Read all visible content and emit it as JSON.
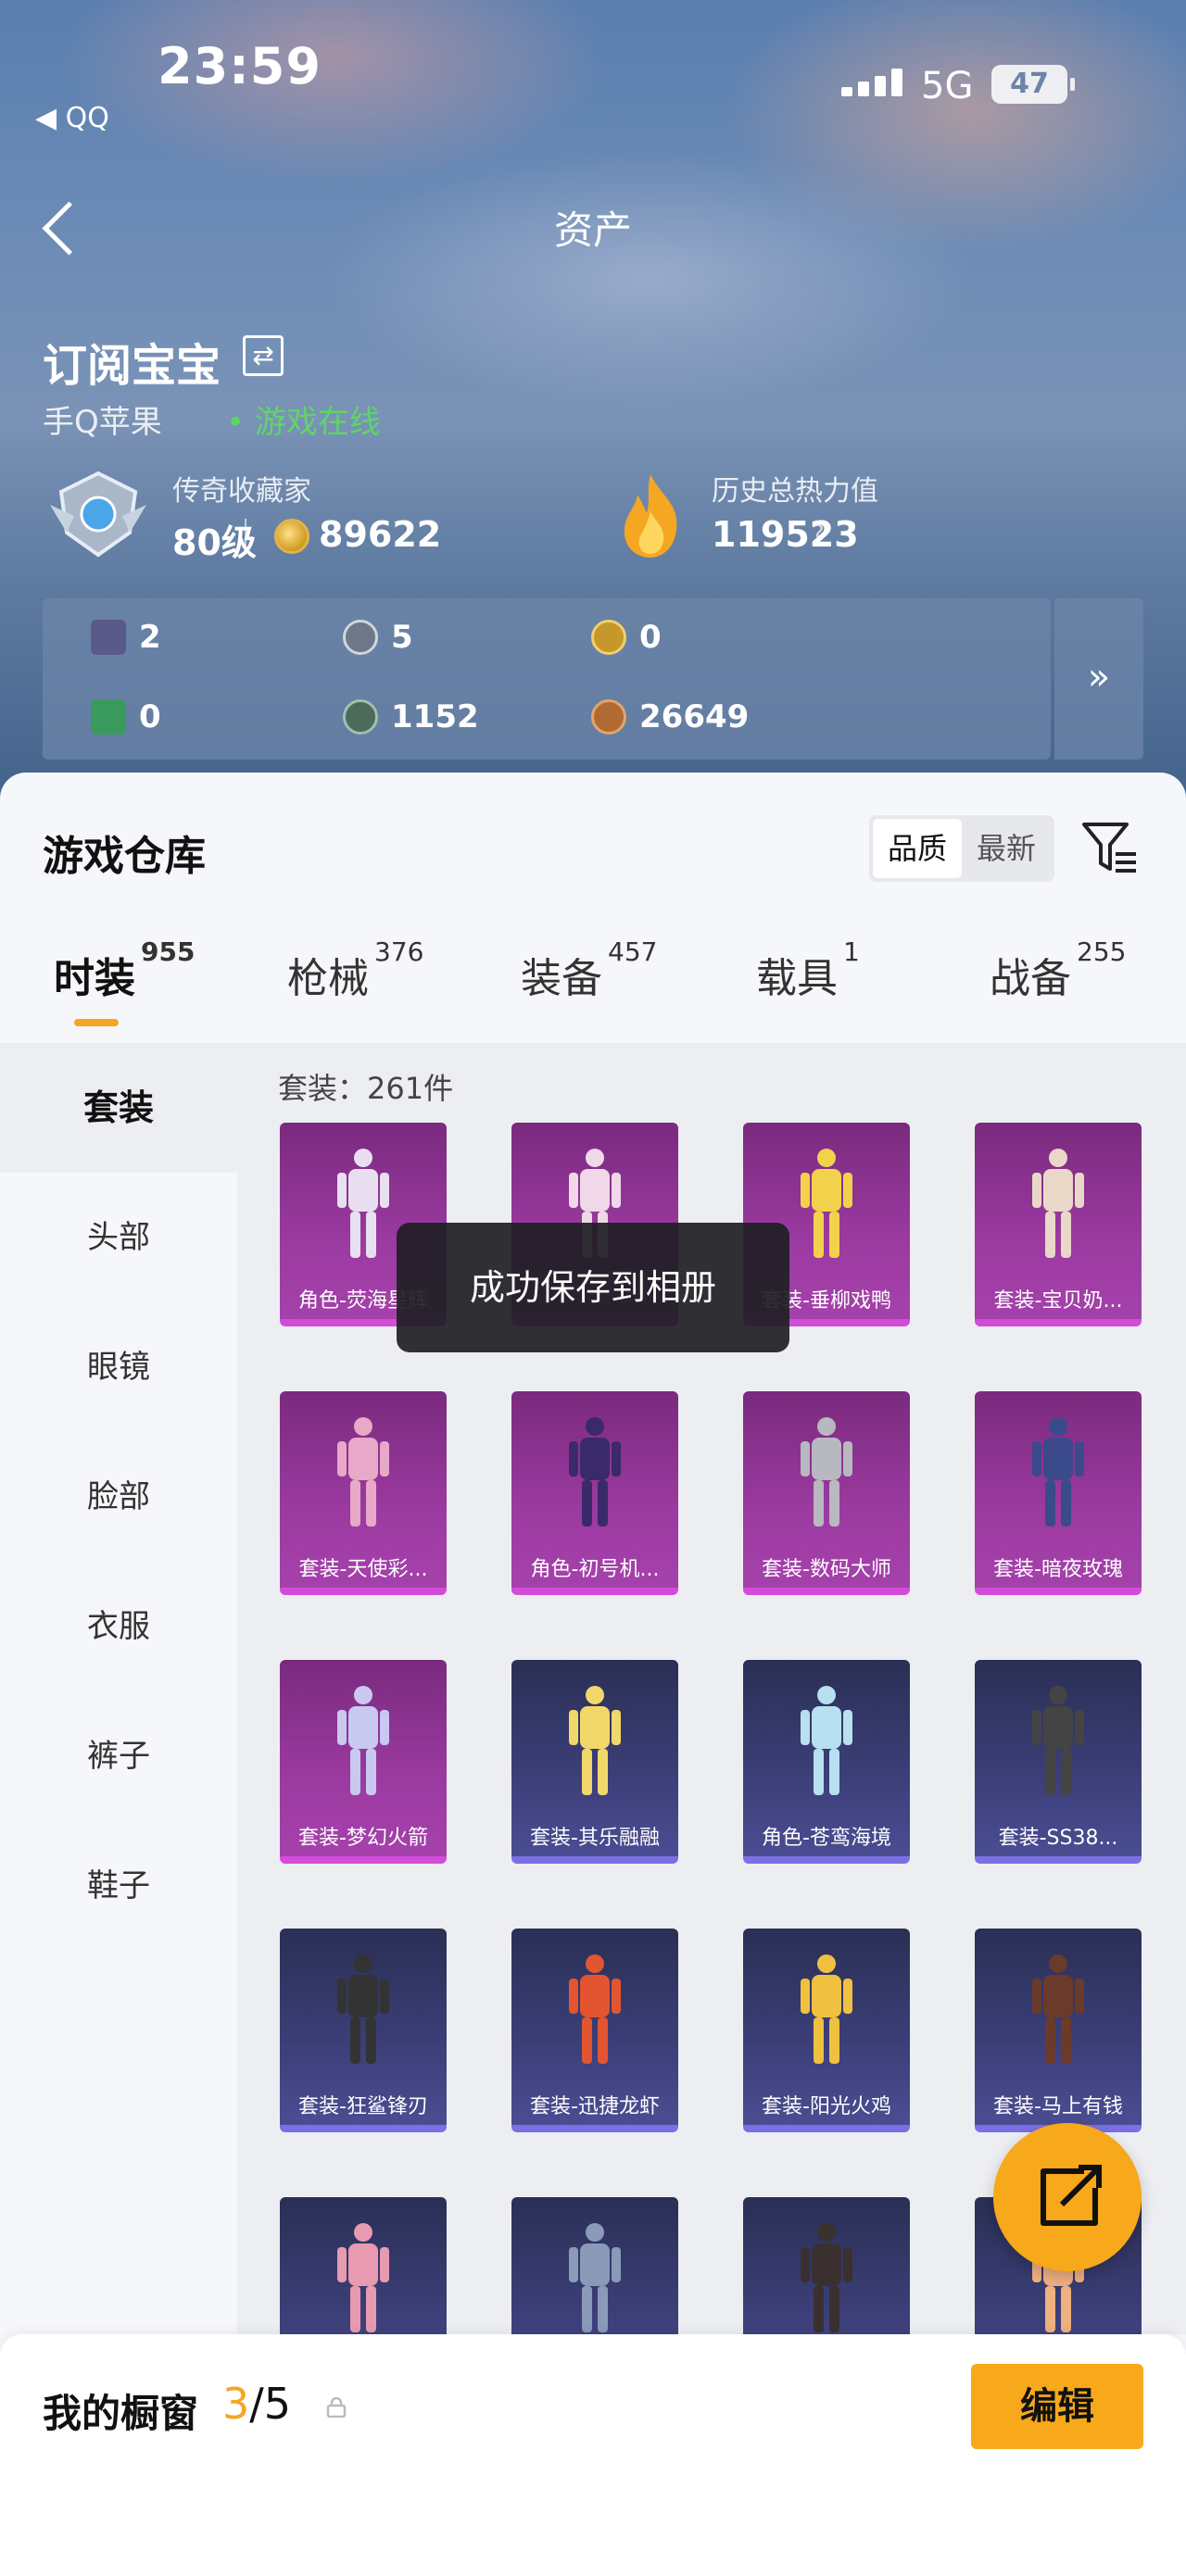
{
  "status_bar": {
    "time": "23:59",
    "back_app": "◀ QQ",
    "network": "5G",
    "battery": "47"
  },
  "nav": {
    "title": "资产"
  },
  "profile": {
    "name": "订阅宝宝",
    "platform": "手Q苹果",
    "online_status": "• 游戏在线",
    "rank_title": "传奇收藏家",
    "level": "80级",
    "collection_points": "89622",
    "heat_label": "历史总热力值",
    "heat_value": "119523",
    "help": "?"
  },
  "currencies": [
    {
      "icon": "card-icon",
      "value": "2",
      "color": "#5a5a8a"
    },
    {
      "icon": "silver-coin-icon",
      "value": "5",
      "color": "#6f7888"
    },
    {
      "icon": "gold-coin-icon",
      "value": "0",
      "color": "#c7972b"
    },
    {
      "icon": "green-card-icon",
      "value": "0",
      "color": "#3a9a5e"
    },
    {
      "icon": "bronze-ball-icon",
      "value": "1152",
      "color": "#4d6a5a"
    },
    {
      "icon": "copper-coin-icon",
      "value": "26649",
      "color": "#b06a32"
    }
  ],
  "currency_more": "»",
  "warehouse": {
    "title": "游戏仓库",
    "sort_options": [
      "品质",
      "最新"
    ],
    "sort_active": "品质"
  },
  "tabs": [
    {
      "label": "时装",
      "count": "955",
      "active": true
    },
    {
      "label": "枪械",
      "count": "376",
      "active": false
    },
    {
      "label": "装备",
      "count": "457",
      "active": false
    },
    {
      "label": "载具",
      "count": "1",
      "active": false
    },
    {
      "label": "战备",
      "count": "255",
      "active": false
    }
  ],
  "side_categories": [
    "套装",
    "头部",
    "眼镜",
    "脸部",
    "衣服",
    "裤子",
    "鞋子"
  ],
  "count_label": "套装：261件",
  "items": [
    {
      "name": "角色-荧海星辉",
      "rarity": "purple"
    },
    {
      "name": "",
      "rarity": "purple"
    },
    {
      "name": "套装-垂柳戏鸭",
      "rarity": "purple"
    },
    {
      "name": "套装-宝贝奶...",
      "rarity": "purple"
    },
    {
      "name": "套装-天使彩...",
      "rarity": "purple"
    },
    {
      "name": "角色-初号机...",
      "rarity": "purple"
    },
    {
      "name": "套装-数码大师",
      "rarity": "purple"
    },
    {
      "name": "套装-暗夜玫瑰",
      "rarity": "purple"
    },
    {
      "name": "套装-梦幻火箭",
      "rarity": "purple"
    },
    {
      "name": "套装-其乐融融",
      "rarity": "blue"
    },
    {
      "name": "角色-苍鸾海境",
      "rarity": "blue"
    },
    {
      "name": "套装-SS38...",
      "rarity": "blue"
    },
    {
      "name": "套装-狂鲨锋刃",
      "rarity": "blue"
    },
    {
      "name": "套装-迅捷龙虾",
      "rarity": "blue"
    },
    {
      "name": "套装-阳光火鸡",
      "rarity": "blue"
    },
    {
      "name": "套装-马上有钱",
      "rarity": "blue"
    },
    {
      "name": "",
      "rarity": "blue"
    },
    {
      "name": "",
      "rarity": "blue"
    },
    {
      "name": "",
      "rarity": "blue"
    },
    {
      "name": "",
      "rarity": "blue"
    }
  ],
  "toast": "成功保存到相册",
  "showcase": {
    "title": "我的橱窗",
    "current": "3",
    "total": "/5",
    "edit": "编辑"
  }
}
